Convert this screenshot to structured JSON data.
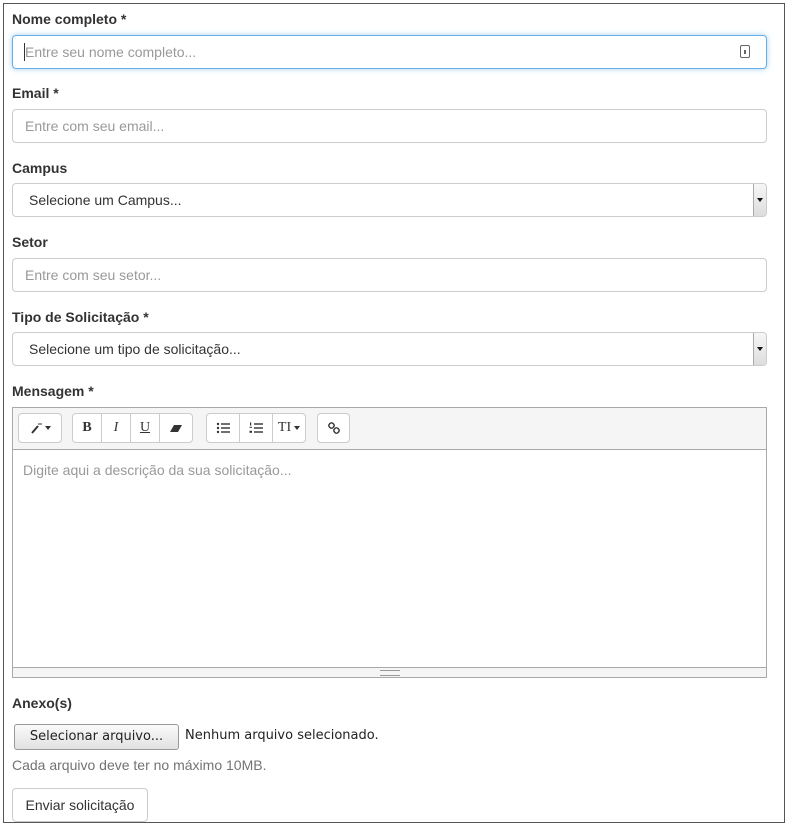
{
  "form": {
    "name": {
      "label": "Nome completo *",
      "placeholder": "Entre seu nome completo..."
    },
    "email": {
      "label": "Email *",
      "placeholder": "Entre com seu email..."
    },
    "campus": {
      "label": "Campus",
      "selected": "Selecione um Campus..."
    },
    "setor": {
      "label": "Setor",
      "placeholder": "Entre com seu setor..."
    },
    "tipo": {
      "label": "Tipo de Solicitação *",
      "selected": "Selecione um tipo de solicitação..."
    },
    "mensagem": {
      "label": "Mensagem *",
      "placeholder": "Digite aqui a descrição da sua solicitação...",
      "toolbar": {
        "style": "style-wand-icon",
        "bold": "B",
        "italic": "I",
        "underline": "U",
        "clear": "eraser-icon",
        "ul": "unordered-list-icon",
        "ol": "ordered-list-icon",
        "fontsize": "TI",
        "link": "link-icon"
      }
    },
    "anexo": {
      "label": "Anexo(s)",
      "button": "Selecionar arquivo...",
      "status": "Nenhum arquivo selecionado.",
      "help": "Cada arquivo deve ter no máximo 10MB."
    },
    "submit": "Enviar solicitação"
  }
}
